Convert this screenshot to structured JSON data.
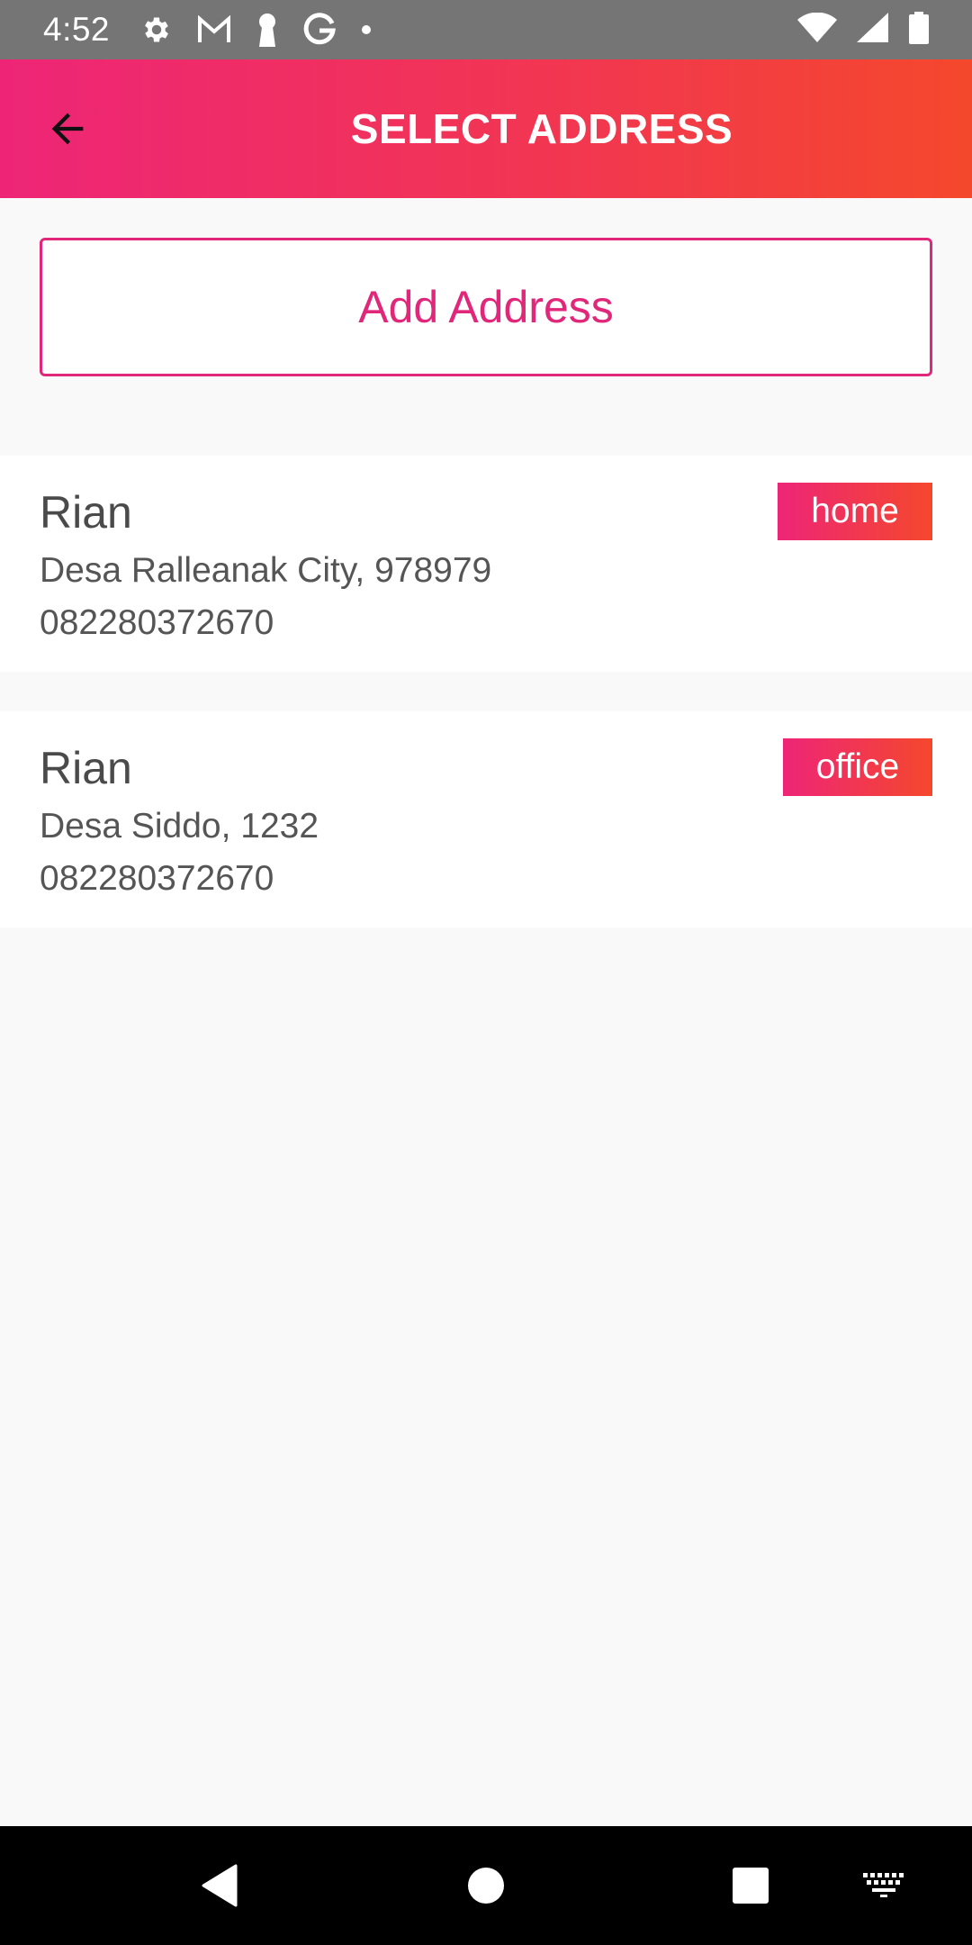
{
  "status_bar": {
    "time": "4:52",
    "left_icons": [
      "settings-icon",
      "gmail-icon",
      "keyhole-icon",
      "google-icon",
      "dot-icon"
    ],
    "right_icons": [
      "wifi-icon",
      "signal-icon",
      "battery-icon"
    ]
  },
  "app_bar": {
    "title": "SELECT ADDRESS",
    "back_icon": "arrow-left-icon"
  },
  "add_address": {
    "label": "Add Address"
  },
  "addresses": [
    {
      "name": "Rian",
      "line": "Desa Ralleanak City, 978979",
      "phone": "082280372670",
      "tag": "home"
    },
    {
      "name": "Rian",
      "line": "Desa Siddo, 1232",
      "phone": "082280372670",
      "tag": "office"
    }
  ],
  "nav_bar": {
    "icons": [
      "back-triangle-icon",
      "home-circle-icon",
      "recents-square-icon",
      "keyboard-icon"
    ]
  },
  "colors": {
    "accent": "#e0277a",
    "gradient_start": "#ee2577",
    "gradient_end": "#f4482c",
    "status_bar": "#757575"
  }
}
